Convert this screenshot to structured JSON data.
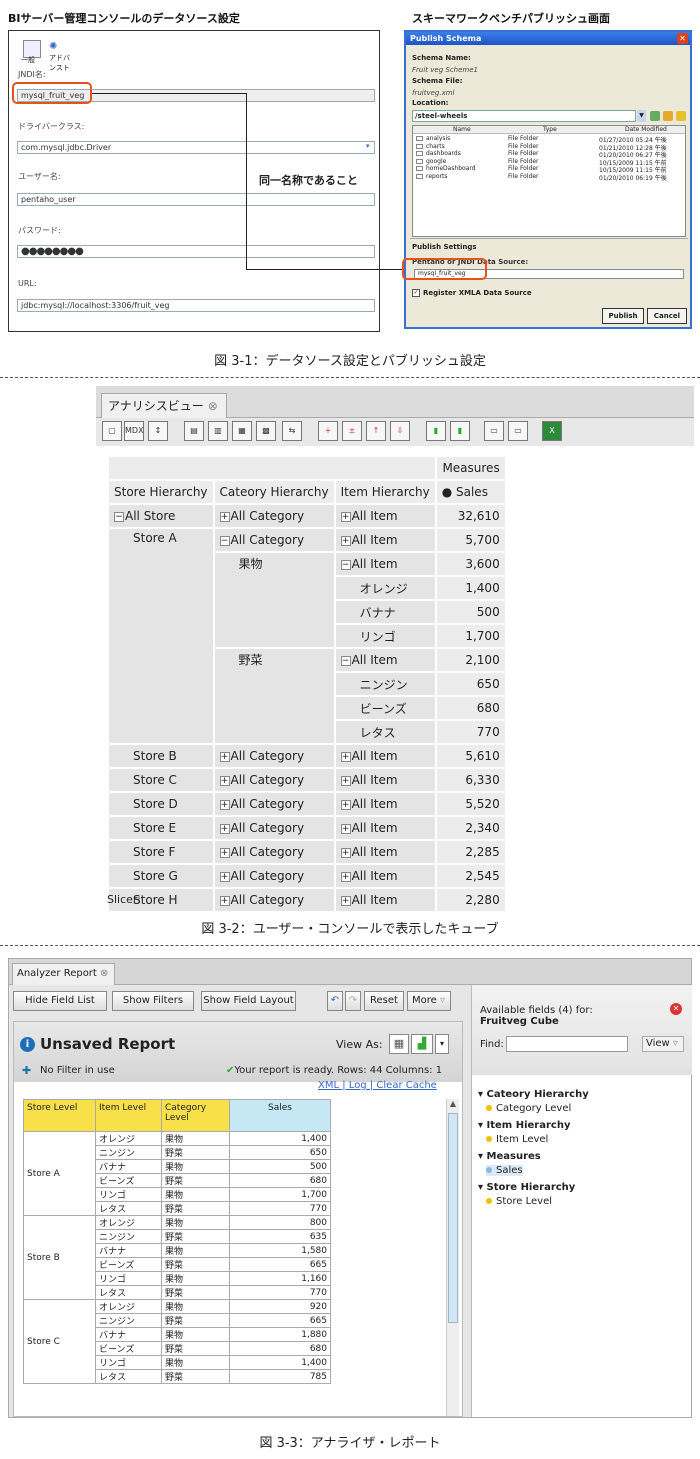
{
  "fig1": {
    "left_title": "BIサーバー管理コンソールのデータソース設定",
    "right_title": "スキーマワークベンチパブリッシュ画面",
    "icons": [
      "一般",
      "アドバンスト"
    ],
    "jndi_label": "JNDI名:",
    "jndi_value": "mysql_fruit_veg",
    "driver_label": "ドライバークラス:",
    "driver_value": "com.mysql.jdbc.Driver",
    "user_label": "ユーザー名:",
    "user_value": "pentaho_user",
    "pass_label": "パスワード:",
    "pass_value": "●●●●●●●●",
    "url_label": "URL:",
    "url_value": "jdbc:mysql://localhost:3306/fruit_veg",
    "note": "同一名称であること",
    "ps": {
      "title": "Publish Schema",
      "name_label": "Schema Name:",
      "name_value": "Fruit veg Scheme1",
      "file_label": "Schema File:",
      "file_value": "fruitveg.xml",
      "loc_label": "Location:",
      "loc_value": "/steel-wheels",
      "cols": [
        "Name",
        "Type",
        "Date Modified"
      ],
      "rows": [
        [
          "analysis",
          "File Folder",
          "01/27/2010 05:24 午後"
        ],
        [
          "charts",
          "File Folder",
          "01/21/2010 12:28 午後"
        ],
        [
          "dashboards",
          "File Folder",
          "01/20/2010 06:27 午後"
        ],
        [
          "google",
          "File Folder",
          "10/15/2009 11:15 午前"
        ],
        [
          "homeDashboard",
          "File Folder",
          "10/15/2009 11:15 午前"
        ],
        [
          "reports",
          "File Folder",
          "01/20/2010 06:19 午後"
        ]
      ],
      "settings_label": "Publish Settings",
      "ds_label": "Pentaho or JNDI Data Source:",
      "ds_value": "mysql_fruit_veg",
      "xmla_label": "Register XMLA Data Source",
      "publish": "Publish",
      "cancel": "Cancel"
    },
    "caption": "図 3-1：データソース設定とパブリッシュ設定"
  },
  "fig2": {
    "tab": "アナリシスビュー",
    "measures": "Measures",
    "headers": [
      "Store Hierarchy",
      "Cateory Hierarchy",
      "Item Hierarchy",
      "Sales"
    ],
    "all_store": "All Store",
    "all_category": "All Category",
    "all_item": "All Item",
    "total": "32,610",
    "store_a": {
      "name": "Store A",
      "total": "5,700",
      "fruit": {
        "name": "果物",
        "total": "3,600",
        "items": [
          [
            "オレンジ",
            "1,400"
          ],
          [
            "バナナ",
            "500"
          ],
          [
            "リンゴ",
            "1,700"
          ]
        ]
      },
      "veg": {
        "name": "野菜",
        "total": "2,100",
        "items": [
          [
            "ニンジン",
            "650"
          ],
          [
            "ビーンズ",
            "680"
          ],
          [
            "レタス",
            "770"
          ]
        ]
      }
    },
    "others": [
      [
        "Store B",
        "5,610"
      ],
      [
        "Store C",
        "6,330"
      ],
      [
        "Store D",
        "5,520"
      ],
      [
        "Store E",
        "2,340"
      ],
      [
        "Store F",
        "2,285"
      ],
      [
        "Store G",
        "2,545"
      ],
      [
        "Store H",
        "2,280"
      ]
    ],
    "slicer": "Slicer:",
    "caption": "図 3-2：ユーザー・コンソールで表示したキューブ"
  },
  "fig3": {
    "tab": "Analyzer Report",
    "btn_hide": "Hide Field List",
    "btn_filters": "Show Filters",
    "btn_layout": "Show Field Layout",
    "btn_reset": "Reset",
    "btn_more": "More",
    "title": "Unsaved Report",
    "view_as": "View As:",
    "no_filter": "No Filter in use",
    "ready": "Your report is ready.",
    "rows_cols": "Rows: 44  Columns: 1",
    "links": [
      "XML",
      "Log",
      "Clear Cache"
    ],
    "headers": [
      "Store Level",
      "Item Level",
      "Category Level",
      "Sales"
    ],
    "groups": [
      {
        "store": "Store A",
        "rows": [
          [
            "オレンジ",
            "果物",
            "1,400"
          ],
          [
            "ニンジン",
            "野菜",
            "650"
          ],
          [
            "バナナ",
            "果物",
            "500"
          ],
          [
            "ビーンズ",
            "野菜",
            "680"
          ],
          [
            "リンゴ",
            "果物",
            "1,700"
          ],
          [
            "レタス",
            "野菜",
            "770"
          ]
        ]
      },
      {
        "store": "Store B",
        "rows": [
          [
            "オレンジ",
            "果物",
            "800"
          ],
          [
            "ニンジン",
            "野菜",
            "635"
          ],
          [
            "バナナ",
            "果物",
            "1,580"
          ],
          [
            "ビーンズ",
            "野菜",
            "665"
          ],
          [
            "リンゴ",
            "果物",
            "1,160"
          ],
          [
            "レタス",
            "野菜",
            "770"
          ]
        ]
      },
      {
        "store": "Store C",
        "rows": [
          [
            "オレンジ",
            "果物",
            "920"
          ],
          [
            "ニンジン",
            "野菜",
            "665"
          ],
          [
            "バナナ",
            "果物",
            "1,880"
          ],
          [
            "ビーンズ",
            "野菜",
            "680"
          ],
          [
            "リンゴ",
            "果物",
            "1,400"
          ],
          [
            "レタス",
            "野菜",
            "785"
          ]
        ]
      }
    ],
    "avail": "Available fields (4) for:",
    "cube": "Fruitveg Cube",
    "find": "Find:",
    "view": "View",
    "fields": [
      [
        "Cateory Hierarchy",
        "Category Level"
      ],
      [
        "Item Hierarchy",
        "Item Level"
      ],
      [
        "Measures",
        "Sales"
      ],
      [
        "Store Hierarchy",
        "Store Level"
      ]
    ],
    "caption": "図 3-3：アナライザ・レポート"
  }
}
